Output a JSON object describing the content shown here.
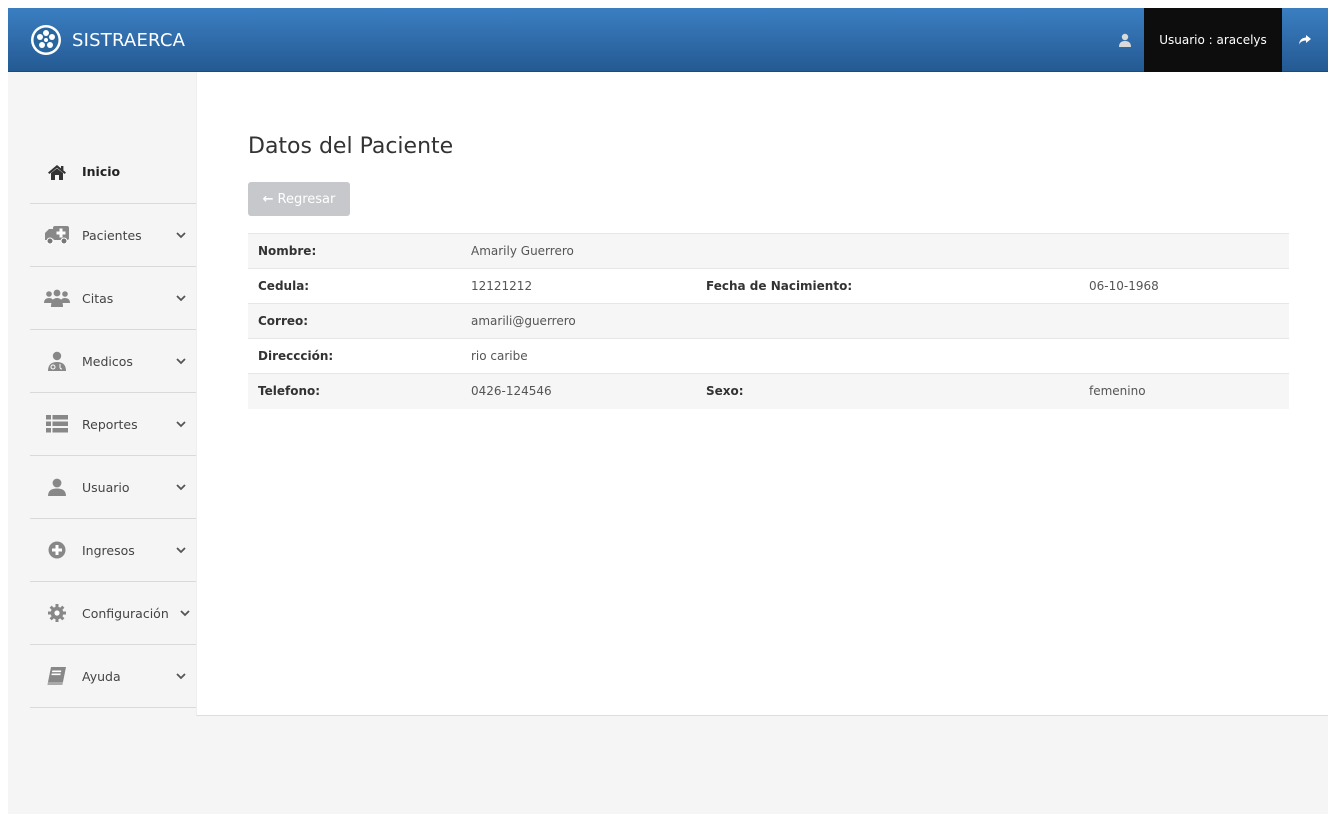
{
  "app": {
    "brand": "SISTRAERCA"
  },
  "navbar": {
    "user_label": "Usuario : aracelys",
    "user_icon": "user-icon",
    "logout_icon": "share-arrow-icon"
  },
  "sidebar": {
    "items": [
      {
        "label": "Inicio",
        "icon": "home-icon"
      },
      {
        "label": "Pacientes",
        "icon": "ambulance-icon"
      },
      {
        "label": "Citas",
        "icon": "users-group-icon"
      },
      {
        "label": "Medicos",
        "icon": "doctor-icon"
      },
      {
        "label": "Reportes",
        "icon": "list-icon"
      },
      {
        "label": "Usuario",
        "icon": "user-icon"
      },
      {
        "label": "Ingresos",
        "icon": "plus-circle-icon"
      },
      {
        "label": "Configuración",
        "icon": "gear-icon"
      },
      {
        "label": "Ayuda",
        "icon": "book-icon"
      }
    ]
  },
  "main": {
    "title": "Datos del Paciente",
    "back_button": "Regresar",
    "patient": {
      "nombre_label": "Nombre:",
      "nombre": "Amarily Guerrero",
      "cedula_label": "Cedula:",
      "cedula": "12121212",
      "fecha_label": "Fecha de Nacimiento:",
      "fecha": "06-10-1968",
      "correo_label": "Correo:",
      "correo": "amarili@guerrero",
      "direccion_label": "Direccción:",
      "direccion": "rio caribe",
      "telefono_label": "Telefono:",
      "telefono": "0426-124546",
      "sexo_label": "Sexo:",
      "sexo": "femenino"
    }
  },
  "colors": {
    "navbar": "#2f6aa8",
    "user_box": "#0d0d0d",
    "button": "#c6c8cb",
    "background": "#f5f5f5"
  }
}
